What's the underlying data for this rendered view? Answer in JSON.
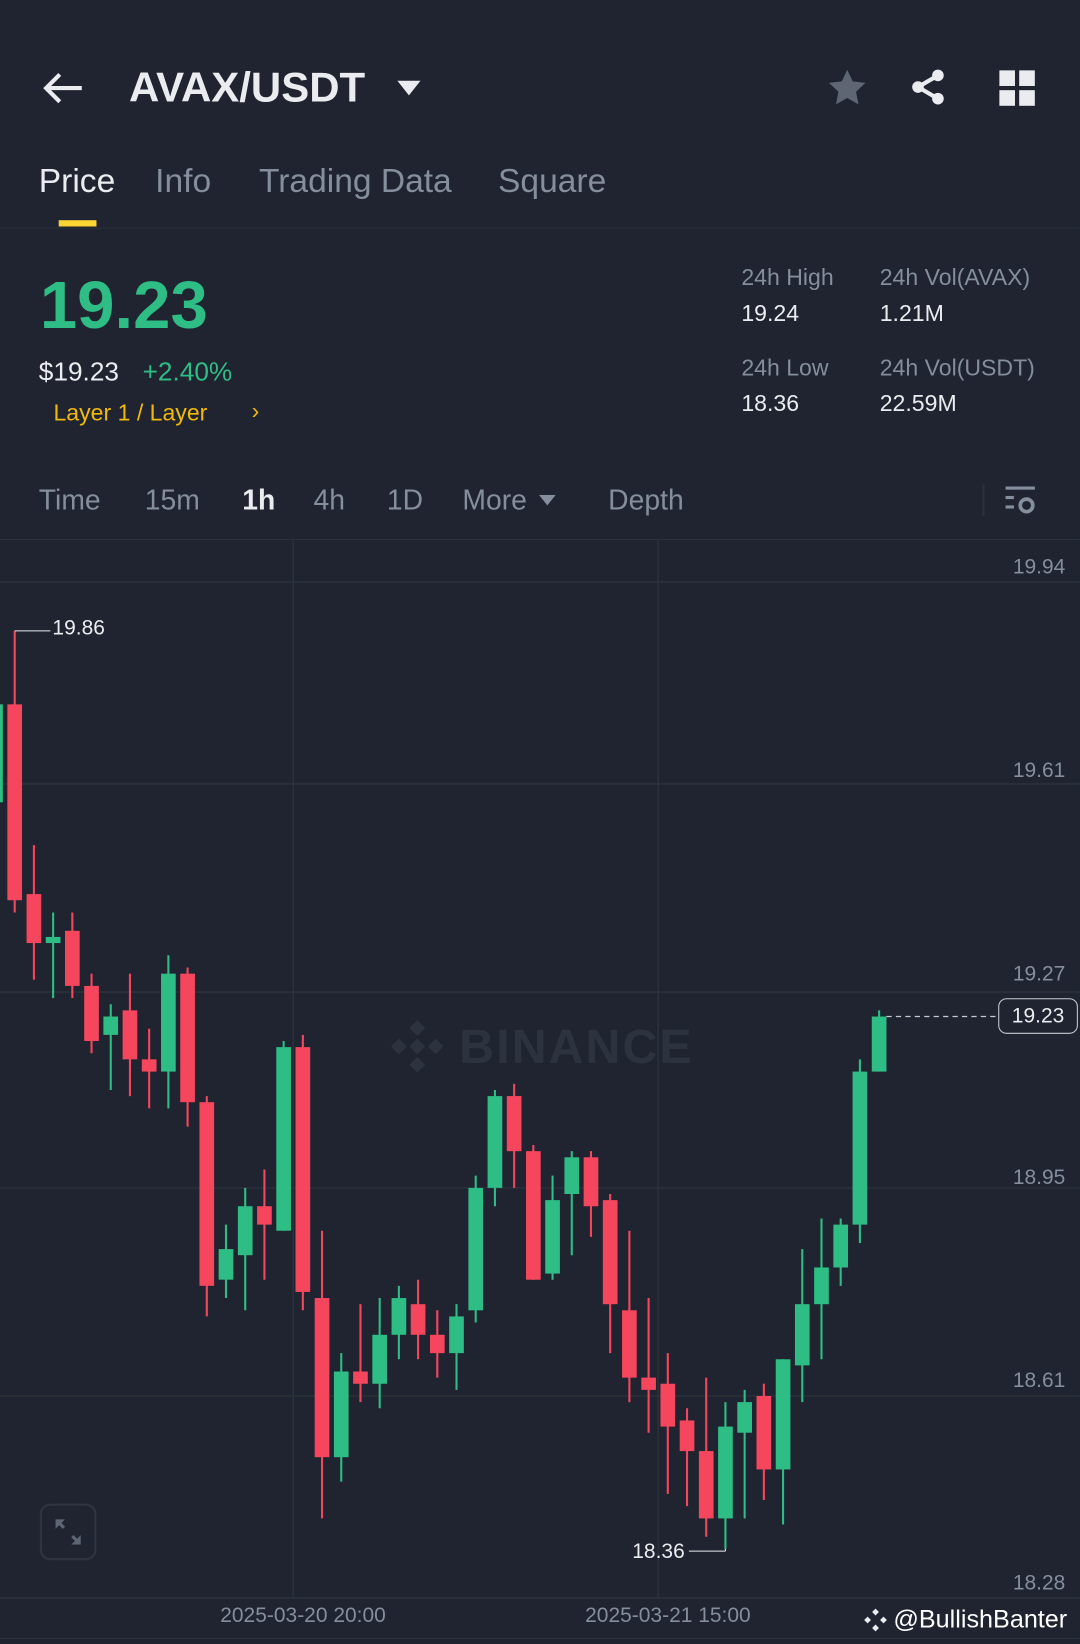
{
  "header": {
    "pair": "AVAX/USDT"
  },
  "tabs": [
    {
      "label": "Price"
    },
    {
      "label": "Info"
    },
    {
      "label": "Trading Data"
    },
    {
      "label": "Square"
    }
  ],
  "ticker": {
    "last_price": "19.23",
    "usd_price": "$19.23",
    "change": "+2.40%",
    "category": "Layer 1 / Layer",
    "stats": [
      {
        "label": "24h High",
        "value": "19.24"
      },
      {
        "label": "24h Vol(AVAX)",
        "value": "1.21M"
      },
      {
        "label": "24h Low",
        "value": "18.36"
      },
      {
        "label": "24h Vol(USDT)",
        "value": "22.59M"
      }
    ]
  },
  "intervals": [
    {
      "label": "Time"
    },
    {
      "label": "15m"
    },
    {
      "label": "1h"
    },
    {
      "label": "4h"
    },
    {
      "label": "1D"
    },
    {
      "label": "More"
    },
    {
      "label": "Depth"
    }
  ],
  "colors": {
    "up": "#2ebd85",
    "down": "#f6465d",
    "accent": "#f0b90b",
    "bg": "#1f2430"
  },
  "watermark": "BINANCE",
  "credit": "@BullishBanter",
  "chart_data": {
    "type": "candlestick",
    "interval": "1h",
    "ylim": [
      18.28,
      19.94
    ],
    "y_ticks": [
      "19.94",
      "19.61",
      "19.27",
      "18.95",
      "18.61",
      "18.28"
    ],
    "x_ticks": [
      {
        "label": "2025-03-20 20:00",
        "index": 15.5
      },
      {
        "label": "2025-03-21 15:00",
        "index": 34.5
      }
    ],
    "max_label": "19.86",
    "min_label": "18.36",
    "current_price_label": "19.23",
    "current_price": 19.23,
    "candles": [
      [
        19.58,
        19.74,
        19.75,
        19.58
      ],
      [
        19.74,
        19.42,
        19.86,
        19.4
      ],
      [
        19.43,
        19.35,
        19.51,
        19.29
      ],
      [
        19.35,
        19.36,
        19.4,
        19.26
      ],
      [
        19.37,
        19.28,
        19.4,
        19.26
      ],
      [
        19.28,
        19.19,
        19.3,
        19.17
      ],
      [
        19.2,
        19.23,
        19.25,
        19.11
      ],
      [
        19.24,
        19.16,
        19.3,
        19.1
      ],
      [
        19.16,
        19.14,
        19.21,
        19.08
      ],
      [
        19.14,
        19.3,
        19.33,
        19.08
      ],
      [
        19.3,
        19.09,
        19.31,
        19.05
      ],
      [
        19.09,
        18.79,
        19.1,
        18.74
      ],
      [
        18.8,
        18.85,
        18.89,
        18.77
      ],
      [
        18.84,
        18.92,
        18.95,
        18.75
      ],
      [
        18.92,
        18.89,
        18.98,
        18.8
      ],
      [
        18.88,
        19.18,
        19.19,
        18.88
      ],
      [
        19.18,
        18.78,
        19.2,
        18.75
      ],
      [
        18.77,
        18.51,
        18.88,
        18.41
      ],
      [
        18.51,
        18.65,
        18.68,
        18.47
      ],
      [
        18.65,
        18.63,
        18.76,
        18.6
      ],
      [
        18.63,
        18.71,
        18.77,
        18.59
      ],
      [
        18.71,
        18.77,
        18.79,
        18.67
      ],
      [
        18.76,
        18.71,
        18.8,
        18.67
      ],
      [
        18.71,
        18.68,
        18.75,
        18.64
      ],
      [
        18.68,
        18.74,
        18.76,
        18.62
      ],
      [
        18.75,
        18.95,
        18.97,
        18.73
      ],
      [
        18.95,
        19.1,
        19.11,
        18.92
      ],
      [
        19.1,
        19.01,
        19.12,
        18.95
      ],
      [
        19.01,
        18.8,
        19.02,
        18.8
      ],
      [
        18.81,
        18.93,
        18.97,
        18.8
      ],
      [
        18.94,
        19.0,
        19.01,
        18.84
      ],
      [
        19.0,
        18.92,
        19.01,
        18.87
      ],
      [
        18.93,
        18.76,
        18.94,
        18.68
      ],
      [
        18.75,
        18.64,
        18.88,
        18.6
      ],
      [
        18.64,
        18.62,
        18.77,
        18.55
      ],
      [
        18.63,
        18.56,
        18.68,
        18.45
      ],
      [
        18.57,
        18.52,
        18.59,
        18.43
      ],
      [
        18.52,
        18.41,
        18.64,
        18.38
      ],
      [
        18.41,
        18.56,
        18.6,
        18.36
      ],
      [
        18.55,
        18.6,
        18.62,
        18.41
      ],
      [
        18.61,
        18.49,
        18.63,
        18.44
      ],
      [
        18.49,
        18.67,
        18.67,
        18.4
      ],
      [
        18.66,
        18.76,
        18.85,
        18.6
      ],
      [
        18.76,
        18.82,
        18.9,
        18.67
      ],
      [
        18.82,
        18.89,
        18.9,
        18.79
      ],
      [
        18.89,
        19.14,
        19.16,
        18.86
      ],
      [
        19.14,
        19.23,
        19.24,
        19.14
      ]
    ]
  }
}
